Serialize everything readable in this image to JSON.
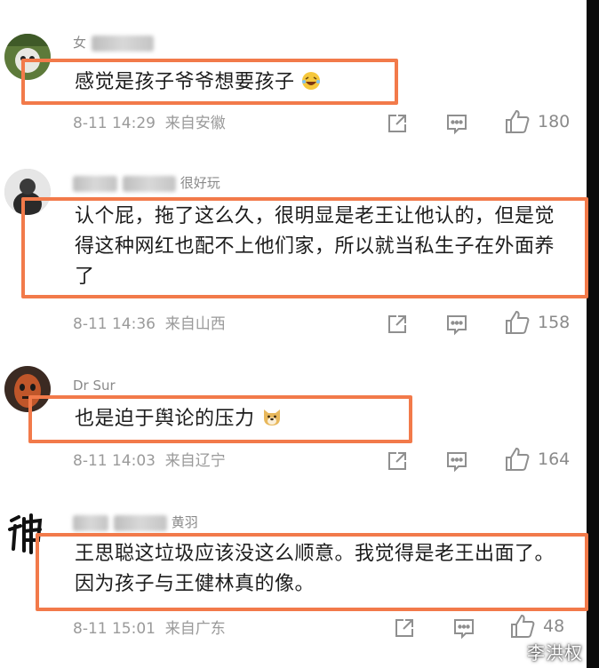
{
  "comments": [
    {
      "username_visible": "女",
      "text": "感觉是孩子爷爷想要孩子",
      "time": "8-11 14:29",
      "location": "来自安徽",
      "likes": "180"
    },
    {
      "username_visible": "很好玩",
      "text": "认个屁，拖了这么久，很明显是老王让他认的，但是觉得这种网红也配不上他们家，所以就当私生子在外面养了",
      "time": "8-11 14:36",
      "location": "来自山西",
      "likes": "158"
    },
    {
      "username_visible": "Dr Sur",
      "text": "也是迫于舆论的压力",
      "time": "8-11 14:03",
      "location": "来自辽宁",
      "likes": "164"
    },
    {
      "username_visible": "黄羽",
      "text": "王思聪这垃圾应该没这么顺意。我觉得是老王出面了。因为孩子与王健林真的像。",
      "time": "8-11 15:01",
      "location": "来自广东",
      "likes": "48"
    }
  ],
  "watermark": "李洪权",
  "colors": {
    "highlight": "#f27a4a",
    "meta": "#9a9a9a",
    "icon": "#8f8f8f"
  },
  "icons": [
    "share-icon",
    "comment-icon",
    "thumbs-up-icon"
  ]
}
